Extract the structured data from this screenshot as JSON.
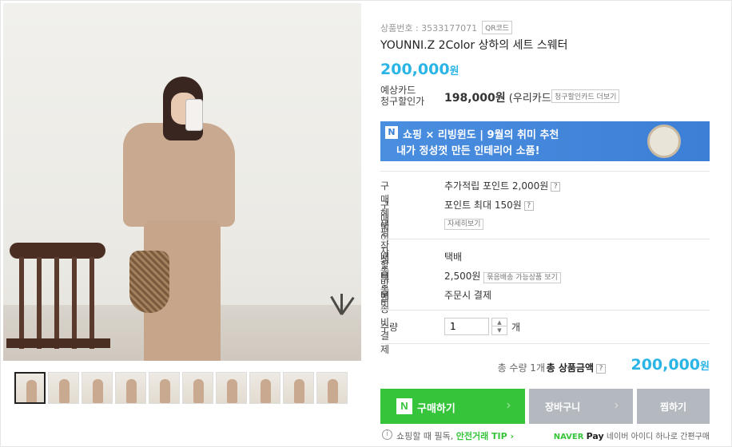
{
  "product": {
    "code_label": "상품번호 : 3533177071",
    "qr_label": "QR코드",
    "title": "YOUNNI.Z 2Color 상하의 세트 스웨터",
    "price": "200,000",
    "price_unit": "원"
  },
  "card_discount": {
    "label_line1": "예상카드",
    "label_line2": "청구할인가",
    "price": "198,000원",
    "card_name": "(우리카드)",
    "more_button": "청구할인카드 더보기"
  },
  "banner": {
    "badge": "N",
    "line1": "쇼핑 × 리빙윈도 | 9월의 취미 추천",
    "line2": "내가 정성껏 만든 인테리어 소품!"
  },
  "benefits": [
    {
      "label": "구매혜택",
      "value": "추가적립 포인트 2,000원",
      "help": "?"
    },
    {
      "label": "구매평작성",
      "value": "포인트 최대 150원",
      "help": "?"
    },
    {
      "label": "무이자할부",
      "value": "",
      "button": "자세히보기"
    }
  ],
  "shipping": [
    {
      "label": "배송방법",
      "value": "택배"
    },
    {
      "label": "배송비",
      "value": "2,500원",
      "button": "묶음배송 가능상품 보기"
    },
    {
      "label": "배송비결제",
      "value": "주문시 결제"
    }
  ],
  "quantity": {
    "label": "수량",
    "value": "1",
    "unit": "개"
  },
  "total": {
    "quantity_text": "총 수량 1개",
    "label": "총 상품금액",
    "help": "?",
    "price": "200,000",
    "unit": "원"
  },
  "buttons": {
    "buy_badge": "N",
    "buy": "구매하기",
    "cart": "장바구니",
    "wish": "찜하기",
    "arrow": "›"
  },
  "footer": {
    "info_icon": "i",
    "text": "쇼핑할 때 필독,",
    "link": "안전거래 TIP ›",
    "naver": "NAVER",
    "pay": "Pay",
    "pay_text": "네이버 아이디 하나로 간편구매"
  },
  "colors": {
    "accent_blue": "#2bb5e6",
    "buy_green": "#35c43a",
    "banner_blue": "#3c7fd6",
    "gray_button": "#b4b9bf"
  }
}
